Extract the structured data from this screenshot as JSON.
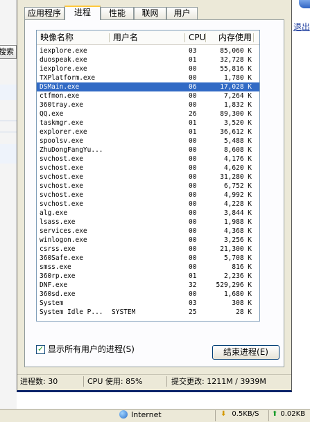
{
  "background": {
    "left_button_text": "搜索",
    "right_link_text": "退出",
    "taskbar": {
      "zone": "Internet",
      "down_rate": "0.5KB/S",
      "up_rate": "0.02KB"
    }
  },
  "tabs": [
    {
      "label": "应用程序"
    },
    {
      "label": "进程"
    },
    {
      "label": "性能"
    },
    {
      "label": "联网"
    },
    {
      "label": "用户"
    }
  ],
  "columns": {
    "name": "映像名称",
    "user": "用户名",
    "cpu": "CPU",
    "mem": "内存使用"
  },
  "processes": [
    {
      "name": "iexplore.exe",
      "user": "",
      "cpu": "03",
      "mem": "85,060 K"
    },
    {
      "name": "duospeak.exe",
      "user": "",
      "cpu": "01",
      "mem": "32,728 K"
    },
    {
      "name": "iexplore.exe",
      "user": "",
      "cpu": "00",
      "mem": "55,816 K"
    },
    {
      "name": "TXPlatform.exe",
      "user": "",
      "cpu": "00",
      "mem": "1,780 K"
    },
    {
      "name": "DSMain.exe",
      "user": "",
      "cpu": "06",
      "mem": "17,028 K",
      "selected": true
    },
    {
      "name": "ctfmon.exe",
      "user": "",
      "cpu": "00",
      "mem": "7,264 K"
    },
    {
      "name": "360tray.exe",
      "user": "",
      "cpu": "00",
      "mem": "1,832 K"
    },
    {
      "name": "QQ.exe",
      "user": "",
      "cpu": "26",
      "mem": "89,300 K"
    },
    {
      "name": "taskmgr.exe",
      "user": "",
      "cpu": "01",
      "mem": "3,520 K"
    },
    {
      "name": "explorer.exe",
      "user": "",
      "cpu": "01",
      "mem": "36,612 K"
    },
    {
      "name": "spoolsv.exe",
      "user": "",
      "cpu": "00",
      "mem": "5,488 K"
    },
    {
      "name": "ZhuDongFangYu...",
      "user": "",
      "cpu": "00",
      "mem": "8,608 K"
    },
    {
      "name": "svchost.exe",
      "user": "",
      "cpu": "00",
      "mem": "4,176 K"
    },
    {
      "name": "svchost.exe",
      "user": "",
      "cpu": "00",
      "mem": "4,620 K"
    },
    {
      "name": "svchost.exe",
      "user": "",
      "cpu": "00",
      "mem": "31,280 K"
    },
    {
      "name": "svchost.exe",
      "user": "",
      "cpu": "00",
      "mem": "6,752 K"
    },
    {
      "name": "svchost.exe",
      "user": "",
      "cpu": "00",
      "mem": "4,992 K"
    },
    {
      "name": "svchost.exe",
      "user": "",
      "cpu": "00",
      "mem": "4,228 K"
    },
    {
      "name": "alg.exe",
      "user": "",
      "cpu": "00",
      "mem": "3,844 K"
    },
    {
      "name": "lsass.exe",
      "user": "",
      "cpu": "00",
      "mem": "1,988 K"
    },
    {
      "name": "services.exe",
      "user": "",
      "cpu": "00",
      "mem": "4,368 K"
    },
    {
      "name": "winlogon.exe",
      "user": "",
      "cpu": "00",
      "mem": "3,256 K"
    },
    {
      "name": "csrss.exe",
      "user": "",
      "cpu": "00",
      "mem": "21,300 K"
    },
    {
      "name": "360Safe.exe",
      "user": "",
      "cpu": "00",
      "mem": "5,708 K"
    },
    {
      "name": "smss.exe",
      "user": "",
      "cpu": "00",
      "mem": "816 K"
    },
    {
      "name": "360rp.exe",
      "user": "",
      "cpu": "01",
      "mem": "2,236 K"
    },
    {
      "name": "DNF.exe",
      "user": "",
      "cpu": "32",
      "mem": "529,296 K"
    },
    {
      "name": "360sd.exe",
      "user": "",
      "cpu": "00",
      "mem": "1,680 K"
    },
    {
      "name": "System",
      "user": "",
      "cpu": "03",
      "mem": "308 K"
    },
    {
      "name": "System Idle P...",
      "user": "SYSTEM",
      "cpu": "25",
      "mem": "28 K"
    }
  ],
  "show_all_users": {
    "checked": true,
    "label": "显示所有用户的进程(S)"
  },
  "end_process_button": "结束进程(E)",
  "status": {
    "process_count": "进程数: 30",
    "cpu_usage": "CPU 使用: 85%",
    "commit": "提交更改: 1211M / 3939M"
  },
  "colors": {
    "selection": "#316ac5",
    "window_face": "#ece9d8",
    "tab_highlight": "#ffc83c"
  }
}
